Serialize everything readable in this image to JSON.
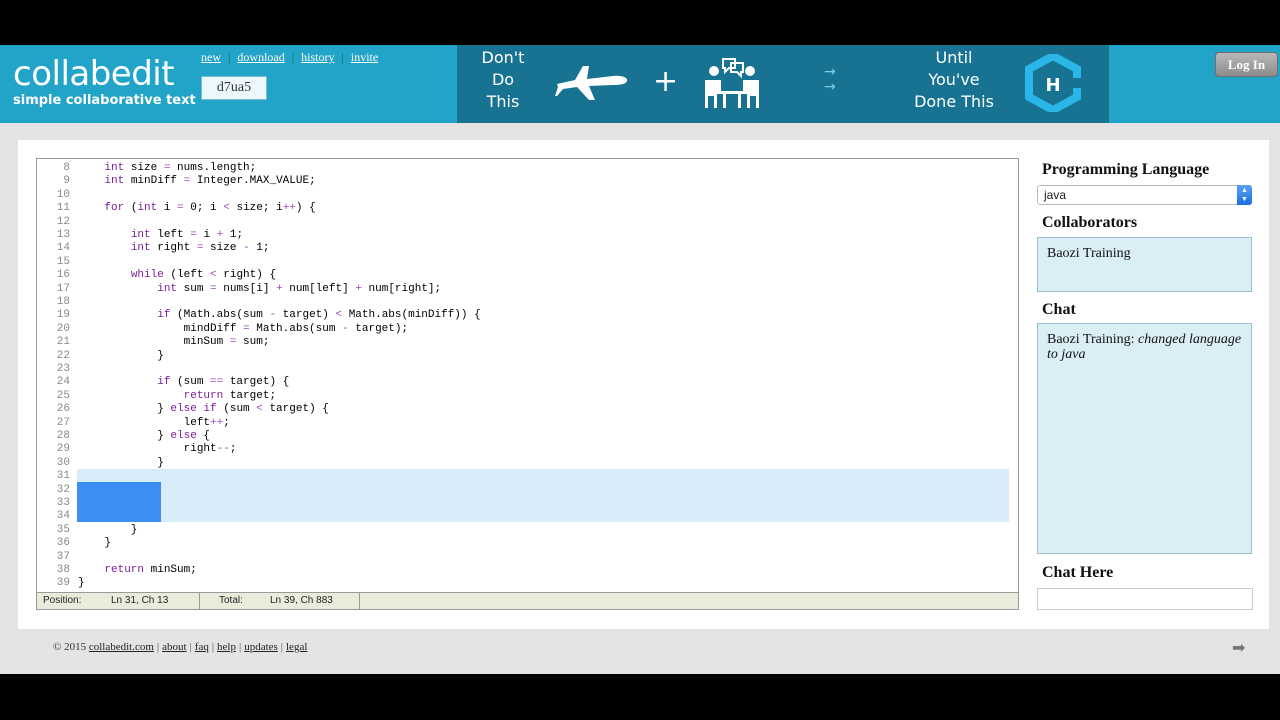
{
  "header": {
    "logo_name": "collabedit",
    "logo_tagline": "simple collaborative text",
    "links": [
      "new",
      "download",
      "history",
      "invite"
    ],
    "doc_id": "d7ua5",
    "login_label": "Log In"
  },
  "ad": {
    "line1": [
      "Don't",
      "Do",
      "This"
    ],
    "plus": "+",
    "arrows": "→",
    "line2": [
      "Until",
      "You've",
      "Done This"
    ],
    "logo_letter": "H"
  },
  "editor": {
    "lines": [
      {
        "n": "8",
        "html": "    <span class=\"kw\">int</span> size <span class=\"op\">=</span> nums.length;"
      },
      {
        "n": "9",
        "html": "    <span class=\"kw\">int</span> minDiff <span class=\"op\">=</span> Integer.MAX_VALUE;"
      },
      {
        "n": "10",
        "html": ""
      },
      {
        "n": "11",
        "html": "    <span class=\"kw\">for</span> (<span class=\"kw\">int</span> i <span class=\"op\">=</span> 0; i <span class=\"op\">&lt;</span> size; i<span class=\"op\">++</span>) {"
      },
      {
        "n": "12",
        "html": ""
      },
      {
        "n": "13",
        "html": "        <span class=\"kw\">int</span> left <span class=\"op\">=</span> i <span class=\"op\">+</span> 1;"
      },
      {
        "n": "14",
        "html": "        <span class=\"kw\">int</span> right <span class=\"op\">=</span> size <span class=\"op\">-</span> 1;"
      },
      {
        "n": "15",
        "html": ""
      },
      {
        "n": "16",
        "html": "        <span class=\"kw\">while</span> (left <span class=\"op\">&lt;</span> right) {"
      },
      {
        "n": "17",
        "html": "            <span class=\"kw\">int</span> sum <span class=\"op\">=</span> nums[i] <span class=\"op\">+</span> num[left] <span class=\"op\">+</span> num[right];"
      },
      {
        "n": "18",
        "html": ""
      },
      {
        "n": "19",
        "html": "            <span class=\"kw\">if</span> (Math.abs(sum <span class=\"op\">-</span> target) <span class=\"op\">&lt;</span> Math.abs(minDiff)) {"
      },
      {
        "n": "20",
        "html": "                mindDiff <span class=\"op\">=</span> Math.abs(sum <span class=\"op\">-</span> target);"
      },
      {
        "n": "21",
        "html": "                minSum <span class=\"op\">=</span> sum;"
      },
      {
        "n": "22",
        "html": "            }"
      },
      {
        "n": "23",
        "html": ""
      },
      {
        "n": "24",
        "html": "            <span class=\"kw\">if</span> (sum <span class=\"op\">==</span> target) {"
      },
      {
        "n": "25",
        "html": "                <span class=\"kw\">return</span> target;"
      },
      {
        "n": "26",
        "html": "            } <span class=\"kw\">else if</span> (sum <span class=\"op\">&lt;</span> target) {"
      },
      {
        "n": "27",
        "html": "                left<span class=\"op\">++</span>;"
      },
      {
        "n": "28",
        "html": "            } <span class=\"kw\">else</span> {"
      },
      {
        "n": "29",
        "html": "                right<span class=\"op\">--</span>;"
      },
      {
        "n": "30",
        "html": "            }"
      },
      {
        "n": "31",
        "html": ""
      },
      {
        "n": "32",
        "html": ""
      },
      {
        "n": "33",
        "html": ""
      },
      {
        "n": "34",
        "html": ""
      },
      {
        "n": "35",
        "html": "        }"
      },
      {
        "n": "36",
        "html": "    }"
      },
      {
        "n": "37",
        "html": ""
      },
      {
        "n": "38",
        "html": "    <span class=\"kw\">return</span> minSum;"
      },
      {
        "n": "39",
        "html": "}"
      }
    ],
    "status": {
      "position_label": "Position:",
      "position_value": "Ln 31, Ch 13",
      "total_label": "Total:",
      "total_value": "Ln 39, Ch 883"
    }
  },
  "sidebar": {
    "language_heading": "Programming Language",
    "language_value": "java",
    "collaborators_heading": "Collaborators",
    "collaborators": [
      "Baozi Training"
    ],
    "chat_heading": "Chat",
    "chat_messages": [
      {
        "user": "Baozi Training:",
        "text": "changed language to java"
      }
    ],
    "chat_here_heading": "Chat Here",
    "chat_input_value": ""
  },
  "footer": {
    "copyright": "© 2015",
    "site_link": "collabedit.com",
    "links": [
      "about",
      "faq",
      "help",
      "updates",
      "legal"
    ],
    "next_arrow": "➡"
  },
  "colors": {
    "header_bg": "#22a3c8",
    "ad_bg": "#177391",
    "selection": "#3d8ef2",
    "active_line": "#d9ecf9",
    "keyword": "#7b1f99"
  }
}
